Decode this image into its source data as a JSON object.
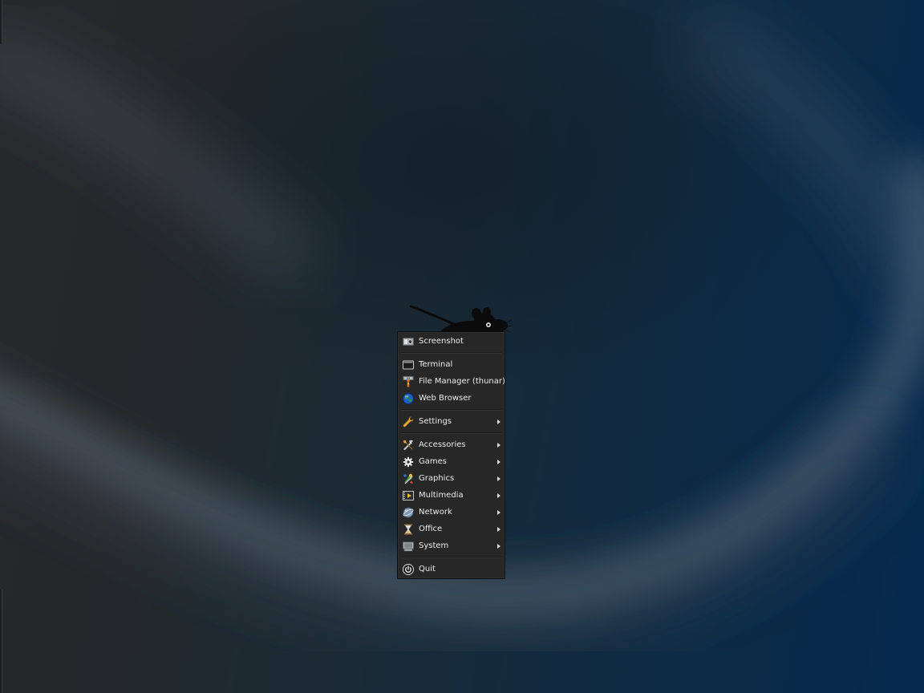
{
  "menu": {
    "screenshot": "Screenshot",
    "terminal": "Terminal",
    "file_manager": "File Manager (thunar)",
    "web_browser": "Web Browser",
    "settings": "Settings",
    "accessories": "Accessories",
    "games": "Games",
    "graphics": "Graphics",
    "multimedia": "Multimedia",
    "network": "Network",
    "office": "Office",
    "system": "System",
    "quit": "Quit"
  },
  "icons": {
    "screenshot": "camera-icon",
    "terminal": "terminal-icon",
    "file_manager": "file-cabinet-icon",
    "web_browser": "globe-icon",
    "settings": "wrench-icon",
    "accessories": "tools-icon",
    "games": "gear-icon",
    "graphics": "paint-icon",
    "multimedia": "film-icon",
    "network": "network-globe-icon",
    "office": "hourglass-icon",
    "system": "computer-icon",
    "quit": "power-icon"
  },
  "colors": {
    "menu_background": "#272727",
    "menu_text": "#ececec",
    "wallpaper_left": "#262829",
    "wallpaper_right": "#052a4f"
  }
}
